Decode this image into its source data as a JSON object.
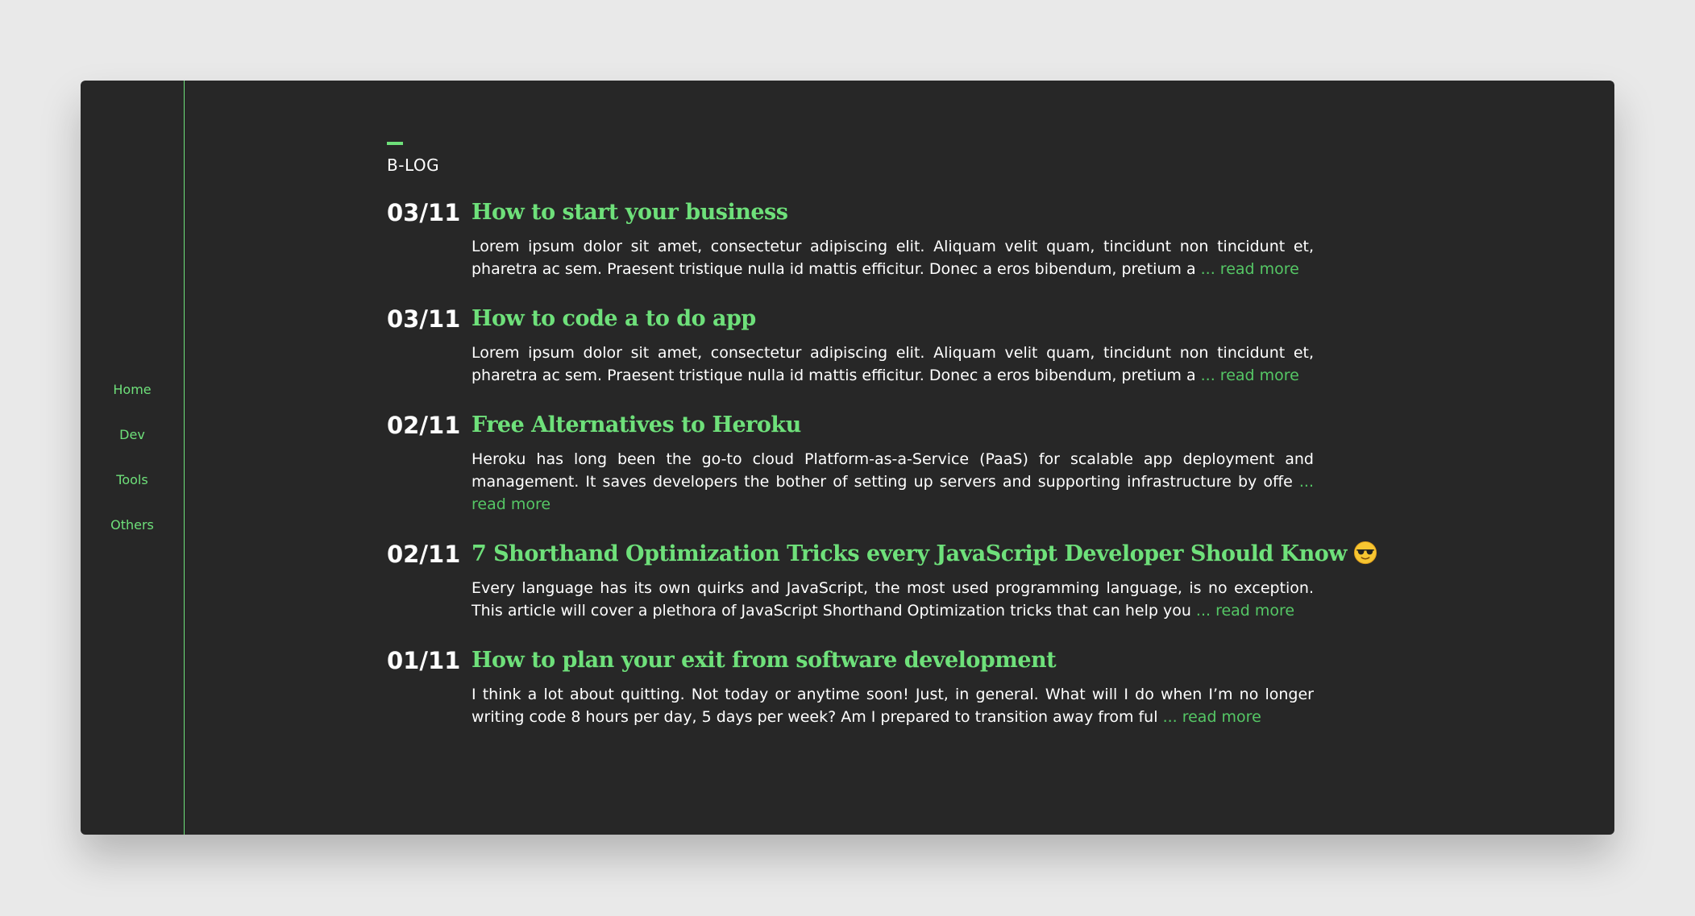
{
  "nav": {
    "items": [
      {
        "label": "Home"
      },
      {
        "label": "Dev"
      },
      {
        "label": "Tools"
      },
      {
        "label": "Others"
      }
    ]
  },
  "blog": {
    "section_title": "B-LOG",
    "posts": [
      {
        "date": "03/11",
        "title": "How to start your business",
        "excerpt": "Lorem ipsum dolor sit amet, consectetur adipiscing elit. Aliquam velit quam, tincidunt non tincidunt et, pharetra ac sem. Praesent tristique nulla id mattis efficitur. Donec a eros bibendum, pretium a",
        "read_more": "... read more"
      },
      {
        "date": "03/11",
        "title": "How to code a to do app",
        "excerpt": "Lorem ipsum dolor sit amet, consectetur adipiscing elit. Aliquam velit quam, tincidunt non tincidunt et, pharetra ac sem. Praesent tristique nulla id mattis efficitur. Donec a eros bibendum, pretium a",
        "read_more": "... read more"
      },
      {
        "date": "02/11",
        "title": "Free Alternatives to Heroku",
        "excerpt": "Heroku has long been the go-to cloud Platform-as-a-Service (PaaS) for scalable app deployment and management. It saves developers the bother of setting up servers and supporting infrastructure by offe",
        "read_more": "... read more"
      },
      {
        "date": "02/11",
        "title": "7 Shorthand Optimization Tricks every JavaScript Developer Should Know",
        "title_icon": "sunglasses-emoji-icon",
        "excerpt": "Every language has its own quirks and JavaScript, the most used programming language, is no exception. This article will cover a plethora of JavaScript Shorthand Optimization tricks that can help you",
        "read_more": "... read more"
      },
      {
        "date": "01/11",
        "title": "How to plan your exit from software development",
        "excerpt": "I think a lot about quitting. Not today or anytime soon! Just, in general. What will I do when I’m no longer writing code 8 hours per day, 5 days per week? Am I prepared to transition away from ful",
        "read_more": "... read more"
      }
    ]
  },
  "colors": {
    "page_background": "#e9e9e9",
    "card_background": "#272727",
    "accent": "#6ee07a",
    "text": "#ffffff"
  }
}
